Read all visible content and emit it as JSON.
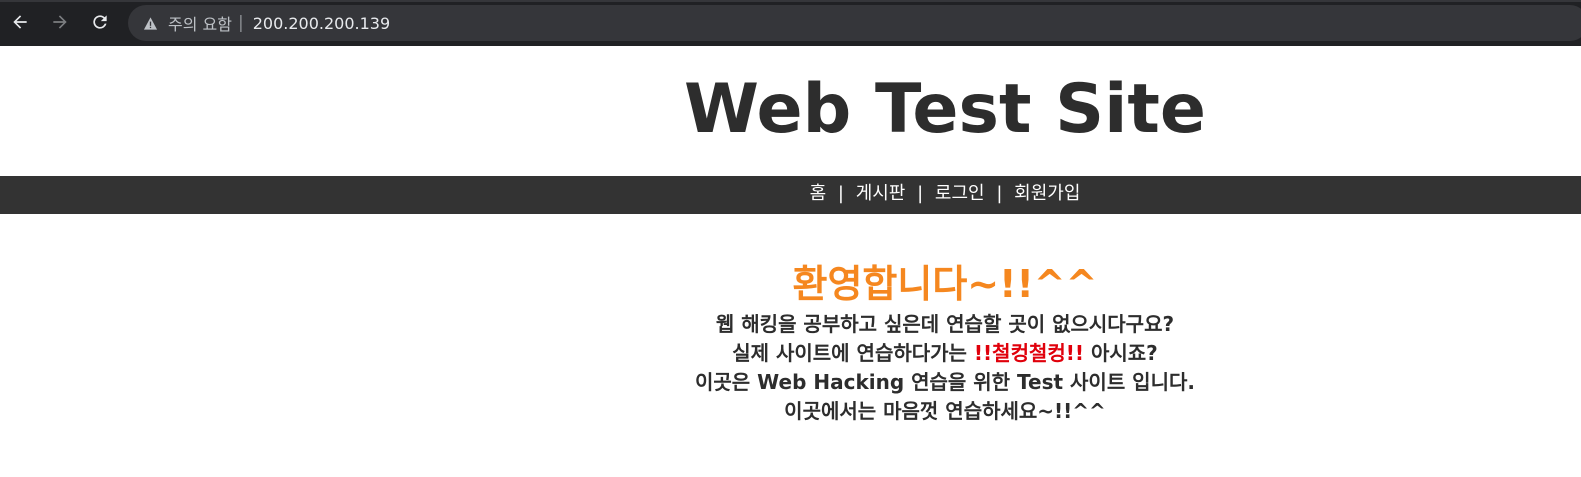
{
  "browser": {
    "warning_label": "주의 요함",
    "separator": "|",
    "url": "200.200.200.139",
    "icons": {
      "back": "arrow-left-icon",
      "forward": "arrow-right-icon",
      "reload": "reload-icon",
      "warning": "warning-triangle-icon"
    }
  },
  "site": {
    "title": "Web Test Site",
    "nav": {
      "items": [
        "홈",
        "게시판",
        "로그인",
        "회원가입"
      ],
      "separator": "|"
    },
    "welcome": "환영합니다~!!^^",
    "lines": {
      "line1": "웹 해킹을 공부하고 싶은데 연습할 곳이 없으시다구요?",
      "line2_pre": "실제 사이트에 연습하다가는 ",
      "line2_highlight": "!!철컹철컹!!",
      "line2_post": " 아시죠?",
      "line3": "이곳은 Web Hacking 연습을 위한 Test 사이트 입니다.",
      "line4": "이곳에서는 마음껏 연습하세요~!!^^"
    }
  },
  "colors": {
    "browser_bg": "#202124",
    "omnibox_bg": "#35363a",
    "title": "#2d2d2d",
    "nav_bg": "#333333",
    "welcome": "#f5871f",
    "highlight": "#e0000b"
  }
}
